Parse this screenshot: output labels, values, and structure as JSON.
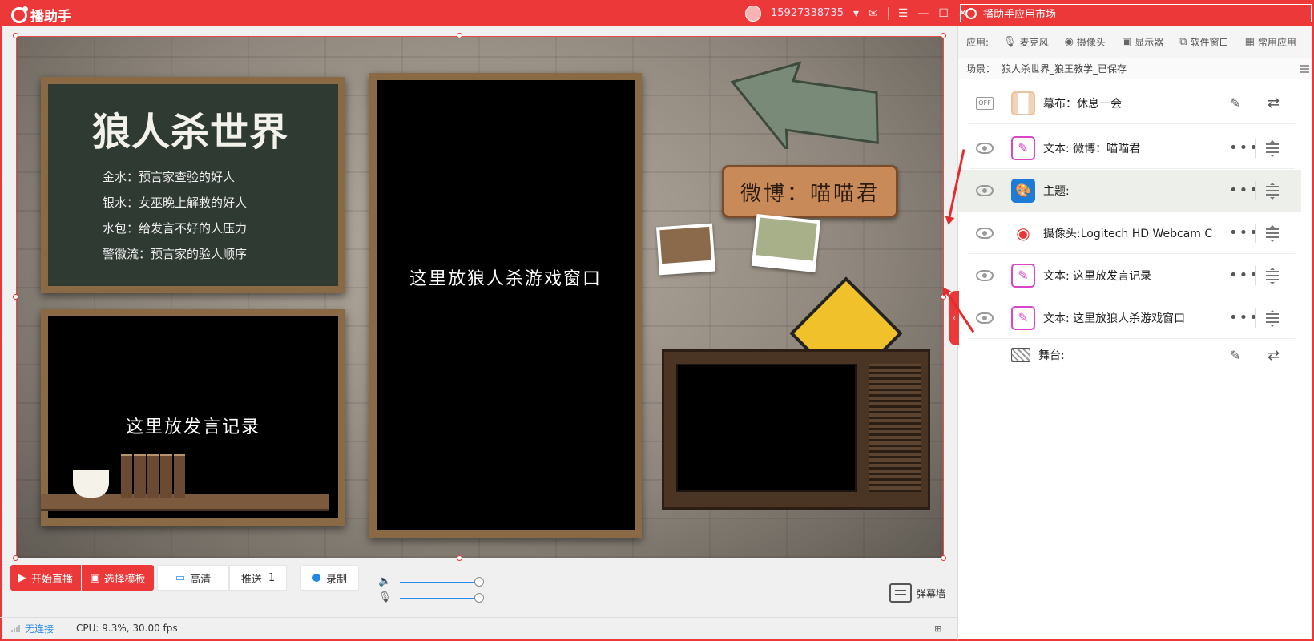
{
  "titlebar": {
    "app_name": "播助手",
    "phone": "15927338735",
    "market_label": "播助手应用市场"
  },
  "stage": {
    "chalk_title": "狼人杀世界",
    "chalk_lines": [
      "金水：预言家查验的好人",
      "银水：女巫晚上解救的好人",
      "水包：给发言不好的人压力",
      "警徽流：预言家的验人顺序"
    ],
    "left_board_text": "这里放发言记录",
    "center_board_text": "这里放狼人杀游戏窗口",
    "weibo_sign": "微博：喵喵君"
  },
  "toolbar": {
    "start_label": "开始直播",
    "template_label": "选择模板",
    "hd_label": "高清",
    "push_label": "推送",
    "push_count": "1",
    "record_label": "录制",
    "danmu_label": "弹幕墙",
    "volume_level": 1.0,
    "mic_level": 1.0
  },
  "status": {
    "connection": "无连接",
    "cpu": "CPU: 9.3%, 30.00 fps"
  },
  "apps": {
    "label": "应用:",
    "items": [
      {
        "label": "麦克风",
        "icon": "microphone-icon"
      },
      {
        "label": "摄像头",
        "icon": "camera-icon"
      },
      {
        "label": "显示器",
        "icon": "monitor-icon"
      },
      {
        "label": "软件窗口",
        "icon": "window-icon"
      },
      {
        "label": "常用应用",
        "icon": "grid-icon"
      }
    ]
  },
  "scene": {
    "label": "场景：",
    "name": "狼人杀世界_狼王教学_已保存"
  },
  "layers": [
    {
      "label": "幕布：休息一会",
      "type": "curtain",
      "visibility": "off"
    },
    {
      "label": "文本: 微博：喵喵君",
      "type": "text",
      "visibility": "eye"
    },
    {
      "label": "主题:",
      "type": "theme",
      "visibility": "eye",
      "selected": true
    },
    {
      "label": "摄像头:Logitech HD Webcam C",
      "type": "camera",
      "visibility": "eye"
    },
    {
      "label": "文本: 这里放发言记录",
      "type": "text",
      "visibility": "eye"
    },
    {
      "label": "文本: 这里放狼人杀游戏窗口",
      "type": "text",
      "visibility": "eye"
    },
    {
      "label": "舞台:",
      "type": "stage",
      "visibility": "none"
    }
  ],
  "colors": {
    "brand": "#ec3838",
    "accent_blue": "#2d8cf0"
  }
}
